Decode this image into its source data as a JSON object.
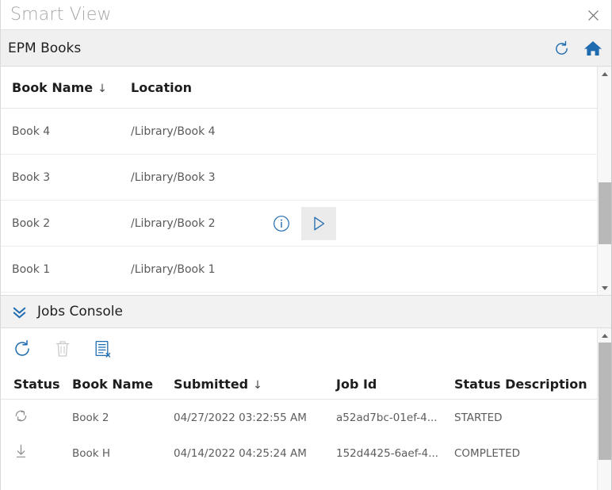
{
  "window": {
    "title": "Smart View",
    "close_label": "×",
    "close_icon": "close-icon"
  },
  "books_panel": {
    "bar_title": "EPM Books",
    "refresh_icon": "refresh-icon",
    "home_icon": "home-icon",
    "columns": [
      {
        "key": "book_name",
        "label": "Book Name",
        "sort": "↓"
      },
      {
        "key": "location",
        "label": "Location",
        "sort": ""
      }
    ],
    "rows": [
      {
        "book_name": "Book 4",
        "location": "/Library/Book 4",
        "actions": []
      },
      {
        "book_name": "Book 3",
        "location": "/Library/Book 3",
        "actions": []
      },
      {
        "book_name": "Book 2",
        "location": "/Library/Book 2",
        "actions": [
          "info-icon",
          "play-icon"
        ]
      },
      {
        "book_name": "Book 1",
        "location": "/Library/Book 1",
        "actions": []
      }
    ]
  },
  "jobs_panel": {
    "bar_title": "Jobs Console",
    "collapse_icon": "double-chevron-down-icon",
    "toolbar": [
      {
        "name": "refresh-icon",
        "enabled": true
      },
      {
        "name": "delete-icon",
        "enabled": false
      },
      {
        "name": "clear-list-icon",
        "enabled": true
      }
    ],
    "columns": [
      {
        "key": "status",
        "label": "Status",
        "sort": ""
      },
      {
        "key": "book_name",
        "label": "Book Name",
        "sort": ""
      },
      {
        "key": "submitted",
        "label": "Submitted",
        "sort": "↓"
      },
      {
        "key": "job_id",
        "label": "Job Id",
        "sort": ""
      },
      {
        "key": "status_description",
        "label": "Status Description",
        "sort": ""
      }
    ],
    "rows": [
      {
        "status_icon": "in-progress-icon",
        "book_name": "Book 2",
        "submitted": "04/27/2022 03:22:55 AM",
        "job_id": "a52ad7bc-01ef-4...",
        "status_description": "STARTED"
      },
      {
        "status_icon": "download-icon",
        "book_name": "Book H",
        "submitted": "04/14/2022 04:25:24 AM",
        "job_id": "152d4425-6aef-4...",
        "status_description": "COMPLETED"
      }
    ]
  },
  "colors": {
    "accent_blue": "#1f6bb0",
    "bar_background": "#f0f0f0",
    "title_gray": "#a6a6a6",
    "scrollbar_thumb": "#b8b8b8",
    "disabled_gray": "#c9c9c9"
  }
}
